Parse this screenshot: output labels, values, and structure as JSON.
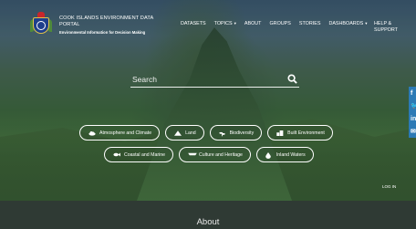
{
  "header": {
    "title": "COOK ISLANDS ENVIRONMENT DATA PORTAL",
    "subtitle": "Environmental Information for Decision Making",
    "logo": "cook-islands-coat-of-arms"
  },
  "nav": {
    "items": [
      {
        "label": "DATASETS",
        "dropdown": false
      },
      {
        "label": "TOPICS",
        "dropdown": true
      },
      {
        "label": "ABOUT",
        "dropdown": false
      },
      {
        "label": "GROUPS",
        "dropdown": false
      },
      {
        "label": "STORIES",
        "dropdown": false
      },
      {
        "label": "DASHBOARDS",
        "dropdown": true
      }
    ],
    "help": "HELP & SUPPORT"
  },
  "search": {
    "placeholder": "Search",
    "value": "",
    "icon": "search-icon"
  },
  "topics_row1": [
    {
      "label": "Atmosphere and Climate",
      "icon": "cloud-icon"
    },
    {
      "label": "Land",
      "icon": "mountain-icon"
    },
    {
      "label": "Biodiversity",
      "icon": "plant-icon"
    },
    {
      "label": "Built Environment",
      "icon": "building-icon"
    }
  ],
  "topics_row2": [
    {
      "label": "Coastal and Marine",
      "icon": "fish-icon"
    },
    {
      "label": "Culture and Heritage",
      "icon": "canoe-icon"
    },
    {
      "label": "Inland Waters",
      "icon": "water-drop-icon"
    }
  ],
  "social": [
    {
      "label": "f",
      "icon": "facebook-icon"
    },
    {
      "label": "🐦",
      "icon": "twitter-icon"
    },
    {
      "label": "in",
      "icon": "linkedin-icon"
    },
    {
      "label": "✉",
      "icon": "email-icon"
    }
  ],
  "login": "LOG IN",
  "about": "About",
  "colors": {
    "social_bg": "#2c7ab5",
    "band_bg": "#2f3a34",
    "text": "#ffffff"
  }
}
